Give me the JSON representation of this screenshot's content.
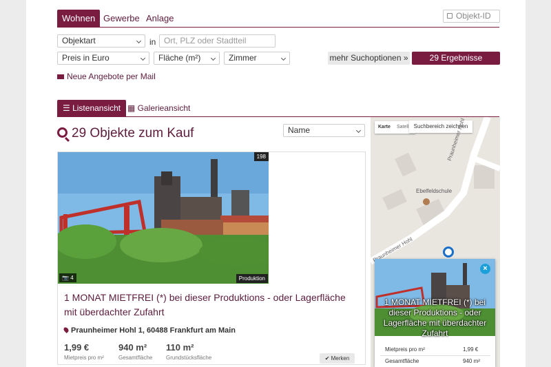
{
  "tabs": [
    "Wohnen",
    "Gewerbe",
    "Anlage"
  ],
  "objekt_id": {
    "placeholder": "Objekt-ID"
  },
  "search": {
    "objektart": "Objektart",
    "in_label": "in",
    "location_placeholder": "Ort, PLZ oder Stadtteil",
    "preis": "Preis in Euro",
    "flaeche": "Fläche (m²)",
    "zimmer": "Zimmer",
    "more_options": "mehr Suchoptionen »",
    "show_results": "29 Ergebnisse anzeigen",
    "mail_link": "Neue Angebote per Mail"
  },
  "views": {
    "list": "Listenansicht",
    "gallery": "Galerieansicht"
  },
  "results": {
    "heading": "29 Objekte zum Kauf",
    "sort": "Name"
  },
  "listing": {
    "image_count": "198",
    "photos": "4",
    "type": "Produktion",
    "title": "1 MONAT MIETFREI (*) bei dieser Produktions - oder Lagerfläche mit überdachter Zufahrt",
    "address": "Praunheimer Hohl 1, 60488 Frankfurt am Main",
    "price": "1,99 €",
    "price_label": "Mietpreis pro m²",
    "area": "940 m²",
    "area_label": "Gesamtfläche",
    "plot": "110 m²",
    "plot_label": "Grundstücksfläche",
    "merken": "Merken"
  },
  "map": {
    "karte": "Karte",
    "satellit": "Satellit",
    "draw": "Suchbereich zeichnen",
    "school": "Ebelfeldschule",
    "street": "Praunheimer Hohl",
    "popup": {
      "title": "1 MONAT MIETFREI (*) bei dieser Produktions - oder Lagerfläche mit überdachter Zufahrt",
      "rows": [
        {
          "label": "Mietpreis pro m²",
          "value": "1,99 €"
        },
        {
          "label": "Gesamtfläche",
          "value": "940 m²"
        }
      ]
    }
  },
  "colors": {
    "brand": "#7a1b40",
    "map_accent": "#1a9fd8"
  }
}
